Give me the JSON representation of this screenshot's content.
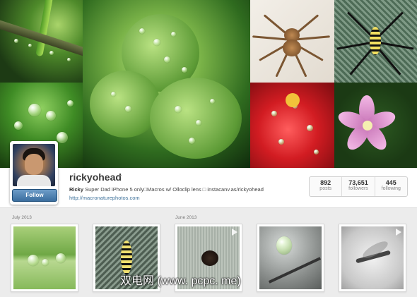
{
  "profile": {
    "username": "rickyohead",
    "name": "Ricky",
    "bio": " Super Dad iPhone 5 only□Macros w/ Olloclip lens □ instacanv.as/rickyohead",
    "website": "http://macronaturephotos.com",
    "follow_label": "Follow"
  },
  "stats": [
    {
      "value": "892",
      "label": "posts"
    },
    {
      "value": "73,651",
      "label": "followers"
    },
    {
      "value": "445",
      "label": "following"
    }
  ],
  "grid": {
    "months": [
      "July 2013",
      "June 2013"
    ]
  },
  "watermark": "双电网 (www. pcpc. me)",
  "icons": {
    "dropdown": "chevron-down-icon",
    "video": "play-icon"
  },
  "colors": {
    "link": "#3f729b",
    "follow_button": "#3b6e9f"
  }
}
